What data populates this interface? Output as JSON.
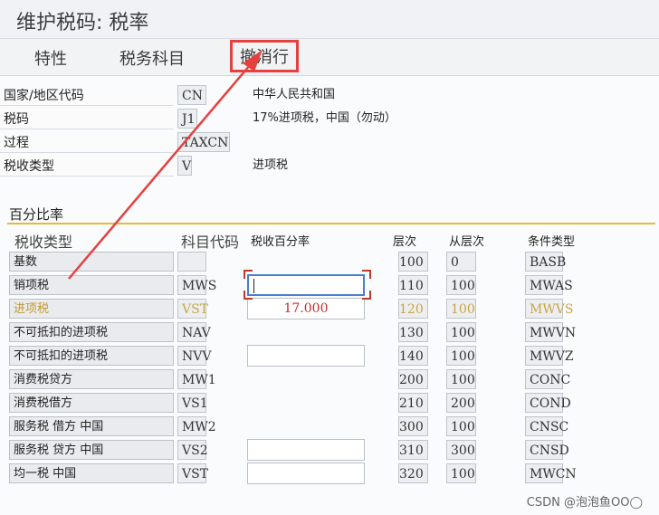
{
  "window": {
    "title": "维护税码: 税率"
  },
  "tabs": [
    {
      "label": "特性"
    },
    {
      "label": "税务科目"
    },
    {
      "label": "撤消行"
    }
  ],
  "header": {
    "country": {
      "label": "国家/地区代码",
      "value": "CN",
      "desc": "中华人民共和国"
    },
    "taxcode": {
      "label": "税码",
      "value": "J1",
      "desc": "17%进项税，中国（勿动）"
    },
    "procedure": {
      "label": "过程",
      "value": "TAXCN"
    },
    "taxtype": {
      "label": "税收类型",
      "value": "V",
      "desc": "进项税"
    }
  },
  "section": {
    "title": "百分比率",
    "columns": {
      "type": "税收类型",
      "acct": "科目代码",
      "rate": "税收百分率",
      "step": "层次",
      "from": "从层次",
      "cond": "条件类型"
    },
    "rows": [
      {
        "type": "基数",
        "acct": "",
        "rate": "",
        "step": "100",
        "from": "0",
        "cond": "BASB"
      },
      {
        "type": "销项税",
        "acct": "MWS",
        "rate": "",
        "step": "110",
        "from": "100",
        "cond": "MWAS"
      },
      {
        "type": "进项税",
        "acct": "VST",
        "rate": "17.000",
        "step": "120",
        "from": "100",
        "cond": "MWVS"
      },
      {
        "type": "不可抵扣的进项税",
        "acct": "NAV",
        "rate": "",
        "step": "130",
        "from": "100",
        "cond": "MWVN"
      },
      {
        "type": "不可抵扣的进项税",
        "acct": "NVV",
        "rate": "",
        "step": "140",
        "from": "100",
        "cond": "MWVZ"
      },
      {
        "type": "消费税贷方",
        "acct": "MW1",
        "rate": "",
        "step": "200",
        "from": "100",
        "cond": "CONC"
      },
      {
        "type": "消费税借方",
        "acct": "VS1",
        "rate": "",
        "step": "210",
        "from": "200",
        "cond": "COND"
      },
      {
        "type": "服务税 借方 中国",
        "acct": "MW2",
        "rate": "",
        "step": "300",
        "from": "100",
        "cond": "CNSC"
      },
      {
        "type": "服务税 贷方 中国",
        "acct": "VS2",
        "rate": "",
        "step": "310",
        "from": "300",
        "cond": "CNSD"
      },
      {
        "type": "均一税 中国",
        "acct": "VST",
        "rate": "",
        "step": "320",
        "from": "100",
        "cond": "MWCN"
      }
    ]
  },
  "watermark": "CSDN @泡泡鱼OO◯",
  "colors": {
    "highlight": "#e6403f",
    "accent": "#e8b93a",
    "input_tax_text": "#c8a644"
  }
}
